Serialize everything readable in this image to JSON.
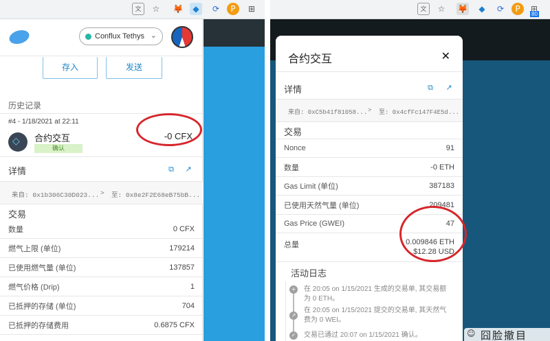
{
  "left": {
    "network": "Conflux Tethys",
    "buttons": {
      "deposit": "存入",
      "send": "发送"
    },
    "history_title": "历史记录",
    "tx": {
      "header": "#4 - 1/18/2021 at 22:11",
      "title": "合约交互",
      "amount": "-0 CFX",
      "status": "确认"
    },
    "details_title": "详情",
    "from_to": {
      "from": "来自: 0x1b306C30D023...",
      "arrow": ">",
      "to": "至: 0x8e2F2E68eB75bB..."
    },
    "transaction_title": "交易",
    "rows": [
      {
        "label": "数量",
        "value": "0 CFX"
      },
      {
        "label": "燃气上限 (单位)",
        "value": "179214"
      },
      {
        "label": "已使用燃气量 (单位)",
        "value": "137857"
      },
      {
        "label": "燃气价格 (Drip)",
        "value": "1"
      },
      {
        "label": "已抵押的存储 (单位)",
        "value": "704"
      },
      {
        "label": "已抵押的存储费用",
        "value": "0.6875 CFX"
      }
    ]
  },
  "right": {
    "modal_title": "合约交互",
    "close": "✕",
    "details_title": "详情",
    "from_to": {
      "from": "来自: 0xC5b41f81058...",
      "arrow": ">",
      "to": "至: 0x4cfFc147F4E5d..."
    },
    "transaction_title": "交易",
    "rows": [
      {
        "label": "Nonce",
        "value": "91"
      },
      {
        "label": "数量",
        "value": "-0 ETH"
      },
      {
        "label": "Gas Limit (单位)",
        "value": "387183"
      },
      {
        "label": "已使用天然气量 (单位)",
        "value": "209481"
      },
      {
        "label": "Gas Price (GWEI)",
        "value": "47"
      }
    ],
    "total": {
      "label": "总量",
      "eth": "0.009846 ETH",
      "usd": "$12.28 USD"
    },
    "activity_title": "活动日志",
    "activity": [
      {
        "icon": "+",
        "line1": "在 20:05 on 1/15/2021 生成的交易单, 其交易额",
        "line2": "为 0 ETH。"
      },
      {
        "icon": "↗",
        "line1": "在 20:05 on 1/15/2021 提交的交易单, 其天然气",
        "line2": "费为 0 WEI。"
      },
      {
        "icon": "✓",
        "line1": "交易已通过 20:07 on 1/15/2021 确认。",
        "line2": ""
      }
    ],
    "watermark": "囧脸撤目",
    "badge": "80"
  },
  "colors": {
    "accent": "#1c88c8",
    "highlight": "#d6262b",
    "blue_bg": "#2a9fe0"
  },
  "icons": [
    "translate-icon",
    "star-icon",
    "metamask-icon",
    "fluent-icon",
    "sync-icon",
    "p-icon",
    "extension-icon"
  ]
}
